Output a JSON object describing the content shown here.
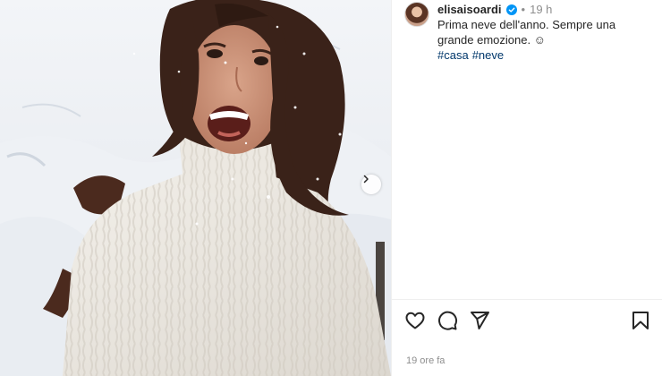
{
  "post": {
    "username": "elisaisoardi",
    "dot": "•",
    "time": "19 h",
    "caption_line1": "Prima neve dell'anno. Sempre una",
    "caption_line2": "grande emozione. ☺",
    "hashtags": [
      "#casa",
      "#neve"
    ],
    "date": "19 ore fa"
  },
  "icons": {
    "verified": "verified-badge-icon",
    "next": "chevron-right-icon",
    "like": "heart-icon",
    "comment": "comment-bubble-icon",
    "share": "paper-plane-icon",
    "save": "bookmark-icon"
  },
  "colors": {
    "verified_blue": "#0095f6",
    "hashtag_blue": "#00376b",
    "meta_gray": "#8e8e8e"
  }
}
